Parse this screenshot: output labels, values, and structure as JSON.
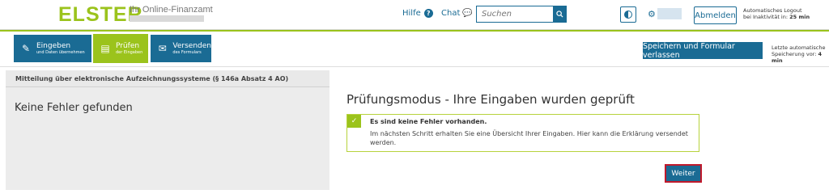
{
  "header": {
    "logo": "ELSTER",
    "subtitle": "Ihr Online-Finanzamt",
    "hilfe_label": "Hilfe",
    "chat_label": "Chat",
    "search_placeholder": "Suchen",
    "abmelden_label": "Abmelden",
    "logout_info_line1": "Automatisches Logout",
    "logout_info_line2": "bei Inaktivität in:",
    "logout_info_time": "25 min"
  },
  "steps": [
    {
      "title": "Eingeben",
      "subtitle": "und Daten übernehmen",
      "icon": "edit-icon",
      "active": false
    },
    {
      "title": "Prüfen",
      "subtitle": "der Eingaben",
      "icon": "document-check-icon",
      "active": true
    },
    {
      "title": "Versenden",
      "subtitle": "des Formulars",
      "icon": "mail-icon",
      "active": false
    }
  ],
  "toolbar": {
    "save_label": "Speichern und Formular verlassen",
    "save_info_line1": "Letzte automatische",
    "save_info_line2": "Speicherung vor:",
    "save_info_time": "4 min"
  },
  "left_panel": {
    "heading": "Mitteilung über elektronische Aufzeichnungssysteme (§ 146a Absatz 4 AO)",
    "message": "Keine Fehler gefunden"
  },
  "main": {
    "title": "Prüfungsmodus - Ihre Eingaben wurden geprüft",
    "alert_head": "Es sind keine Fehler vorhanden.",
    "alert_body": "Im nächsten Schritt erhalten Sie eine Übersicht Ihrer Eingaben. Hier kann die Erklärung versendet werden.",
    "next_label": "Weiter"
  },
  "colors": {
    "brand_green": "#9bc31c",
    "brand_blue": "#1a6b94",
    "highlight_red": "#c0192b"
  }
}
